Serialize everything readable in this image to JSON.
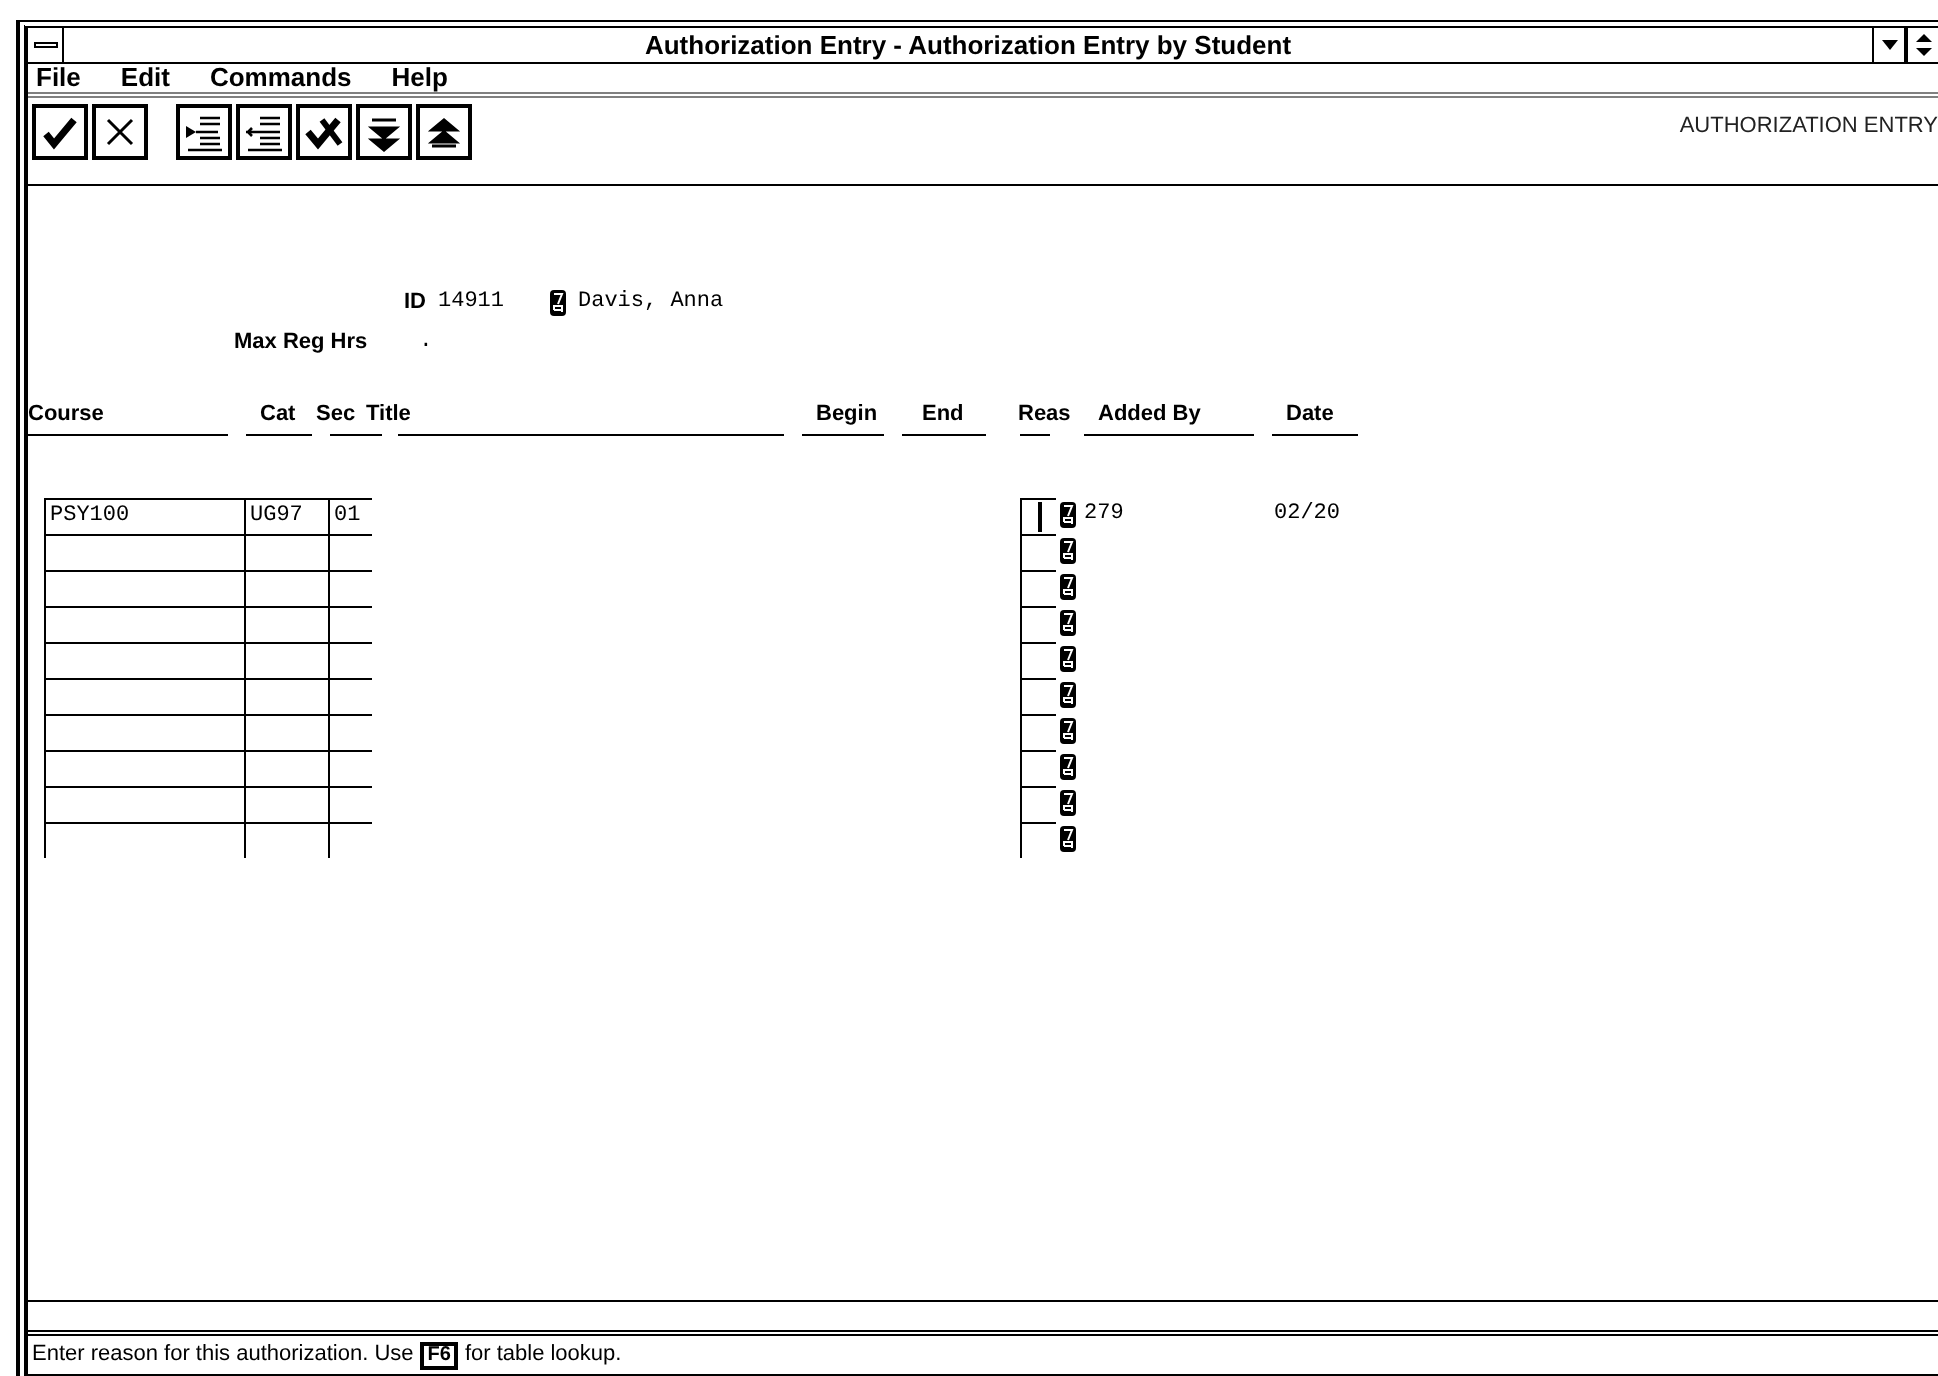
{
  "window": {
    "title": "Authorization Entry - Authorization Entry by Student"
  },
  "menu": [
    {
      "label": "File"
    },
    {
      "label": "Edit"
    },
    {
      "label": "Commands"
    },
    {
      "label": "Help"
    }
  ],
  "toolbar": {
    "groups": [
      [
        {
          "kind": "check"
        },
        {
          "kind": "cancel"
        }
      ],
      [
        {
          "kind": "insert-row"
        },
        {
          "kind": "delete-row"
        },
        {
          "kind": "remove"
        },
        {
          "kind": "next"
        },
        {
          "kind": "previous"
        }
      ]
    ]
  },
  "form_title": "AUTHORIZATION ENTRY",
  "student": {
    "id_label": "ID",
    "id": "14911",
    "name": "Davis, Anna",
    "max_hrs_label": "Max Reg Hrs",
    "max_hrs": "."
  },
  "table": {
    "columns": [
      "Course",
      "Cat",
      "Sec",
      "Title",
      "Begin",
      "End",
      "Reas",
      "Added By",
      "Date"
    ],
    "rows": [
      {
        "course": "PSY100",
        "cat": "UG97",
        "sec": "01",
        "added_by": "279",
        "date": "02/20",
        "focused": true
      },
      {
        "focused": false
      },
      {
        "focused": false
      },
      {
        "focused": false
      },
      {
        "focused": false
      },
      {
        "focused": false
      },
      {
        "focused": false
      },
      {
        "focused": false
      },
      {
        "focused": false
      },
      {
        "focused": false
      }
    ]
  },
  "status": {
    "before": "Enter reason for this authorization.  Use",
    "key": "F6",
    "after": "for table lookup."
  }
}
